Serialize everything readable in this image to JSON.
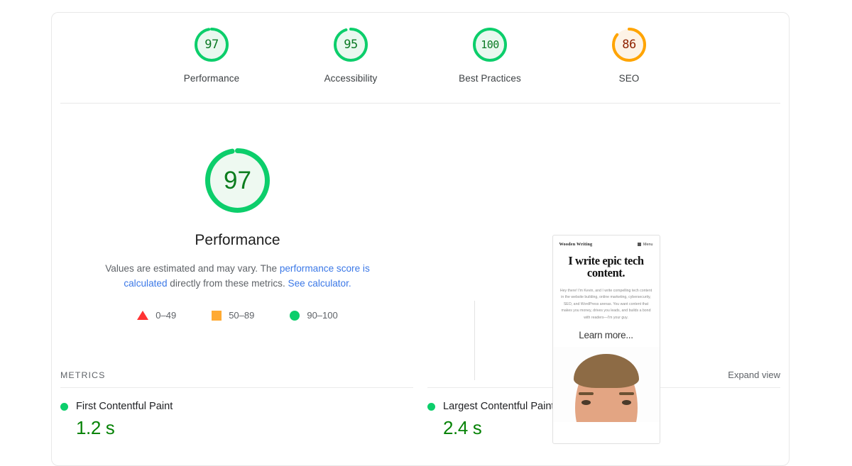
{
  "card": {
    "scores": [
      {
        "label": "Performance",
        "value": "97",
        "pct": 97,
        "ring": "#0cce6b",
        "fill": "#e9f8ef",
        "text": "#0b7a24",
        "icon": "score-gauge-icon"
      },
      {
        "label": "Accessibility",
        "value": "95",
        "pct": 95,
        "ring": "#0cce6b",
        "fill": "#e9f8ef",
        "text": "#0b7a24",
        "icon": "score-gauge-icon"
      },
      {
        "label": "Best Practices",
        "value": "100",
        "pct": 100,
        "ring": "#0cce6b",
        "fill": "#e9f8ef",
        "text": "#0b7a24",
        "icon": "score-gauge-icon"
      },
      {
        "label": "SEO",
        "value": "86",
        "pct": 86,
        "ring": "#ffa400",
        "fill": "#fdf3e6",
        "text": "#8f2200",
        "icon": "score-gauge-icon"
      }
    ],
    "performance": {
      "value": "97",
      "pct": 97,
      "title": "Performance",
      "ring_color": "#0cce6b",
      "fill_color": "#eef9f1",
      "text_color": "#0c7d1e",
      "desc_part1": "Values are estimated and may vary. The ",
      "desc_link1": "performance score is calculated",
      "desc_part2": " directly from these metrics. ",
      "desc_link2": "See calculator.",
      "link_color": "#3b78e7",
      "legend": [
        {
          "marker": "triangle",
          "range": "0–49",
          "color": "#ff3333"
        },
        {
          "marker": "square",
          "range": "50–89",
          "color": "#ffaa33"
        },
        {
          "marker": "circle",
          "range": "90–100",
          "color": "#0cce6b"
        }
      ]
    },
    "thumbnail": {
      "brand": "Wooden Writing",
      "menu_label": "Menu",
      "headline": "I write epic tech content.",
      "body": "Hey there! I'm Kevin, and I write compelling tech content in the website building, online marketing, cybersecurity, SEO, and WordPress arenas. You want content that makes you money, drives you leads, and builds a bond with readers—I'm your guy.",
      "cta": "Learn more..."
    },
    "metrics": {
      "section_title": "METRICS",
      "expand_label": "Expand view",
      "items": [
        {
          "name": "First Contentful Paint",
          "value": "1.2 s",
          "status_color": "#0cce6b"
        },
        {
          "name": "Largest Contentful Paint",
          "value": "2.4 s",
          "status_color": "#0cce6b"
        }
      ]
    }
  }
}
